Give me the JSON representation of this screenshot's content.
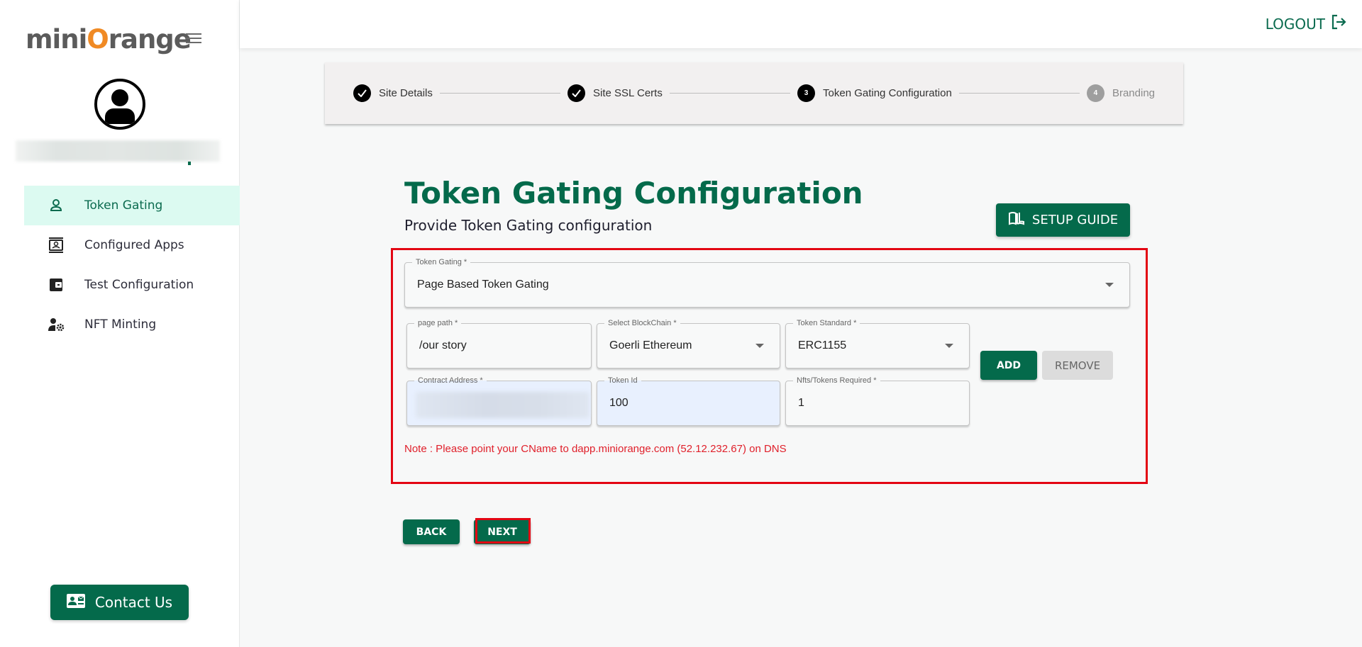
{
  "sidebar": {
    "logo": {
      "prefix": "mini",
      "o": "O",
      "suffix": "range"
    },
    "username": "",
    "items": [
      {
        "label": "Token Gating",
        "icon": "user-icon",
        "active": true
      },
      {
        "label": "Configured Apps",
        "icon": "contact-card-icon",
        "active": false
      },
      {
        "label": "Test Configuration",
        "icon": "wallet-icon",
        "active": false
      },
      {
        "label": "NFT Minting",
        "icon": "user-settings-icon",
        "active": false
      }
    ],
    "contact_label": "Contact Us"
  },
  "header": {
    "logout_label": "LOGOUT"
  },
  "stepper": {
    "steps": [
      {
        "label": "Site Details",
        "status": "completed",
        "number": "1"
      },
      {
        "label": "Site SSL Certs",
        "status": "completed",
        "number": "2"
      },
      {
        "label": "Token Gating Configuration",
        "status": "active",
        "number": "3"
      },
      {
        "label": "Branding",
        "status": "pending",
        "number": "4"
      }
    ]
  },
  "page": {
    "title": "Token Gating Configuration",
    "subtitle": "Provide Token Gating configuration",
    "setup_guide_label": "SETUP GUIDE"
  },
  "form": {
    "token_gating": {
      "label": "Token Gating *",
      "value": "Page Based Token Gating"
    },
    "page_path": {
      "label": "page path *",
      "value": "/our story"
    },
    "blockchain": {
      "label": "Select BlockChain *",
      "value": "Goerli Ethereum"
    },
    "token_standard": {
      "label": "Token Standard *",
      "value": "ERC1155"
    },
    "contract_address": {
      "label": "Contract Address *",
      "value": ""
    },
    "token_id": {
      "label": "Token Id",
      "value": "100"
    },
    "tokens_required": {
      "label": "Nfts/Tokens Required *",
      "value": "1"
    },
    "add_label": "ADD",
    "remove_label": "REMOVE",
    "note": "Note : Please point your CName to dapp.miniorange.com (52.12.232.67) on DNS"
  },
  "footer": {
    "back_label": "BACK",
    "next_label": "NEXT"
  },
  "colors": {
    "brand": "#046a4b",
    "active_bg": "#dcfaf1",
    "note": "#e0202b",
    "highlight": "#e30613"
  }
}
